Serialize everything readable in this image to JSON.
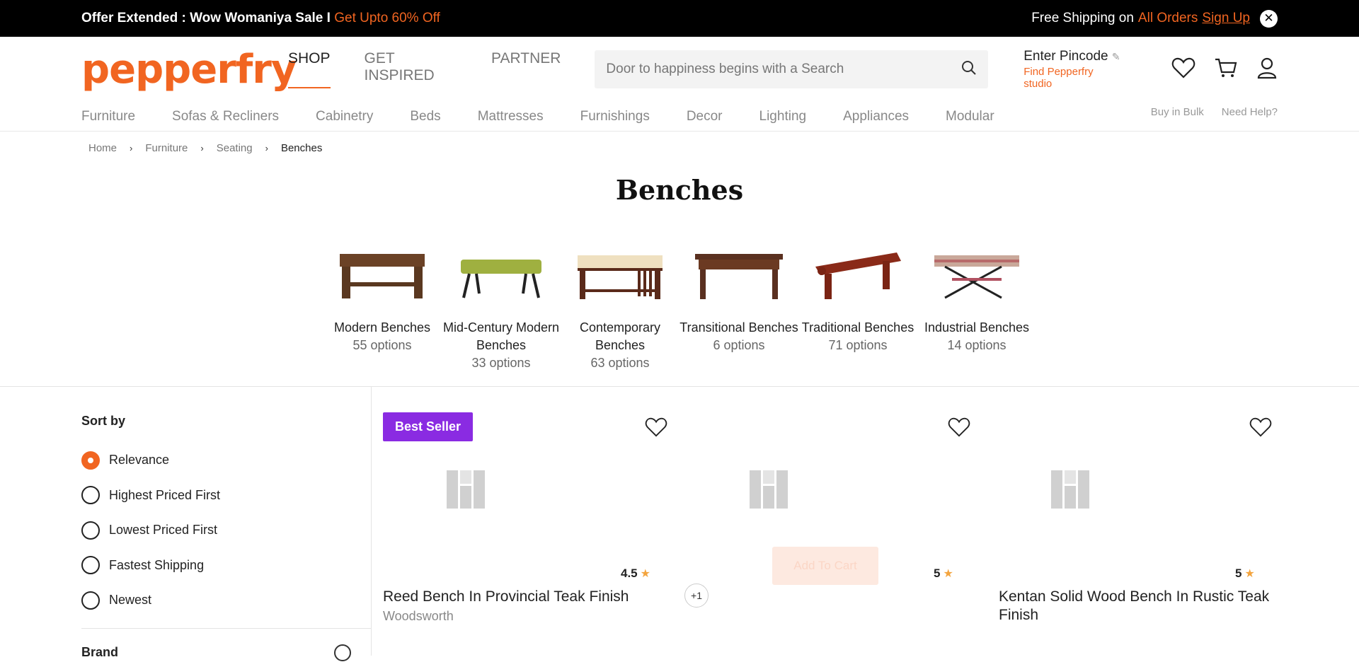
{
  "topbar": {
    "offer_text": "Offer Extended : Wow Womaniya Sale I",
    "offer_highlight": "Get Upto 60% Off",
    "shipping_text": "Free Shipping on",
    "shipping_highlight": "All Orders",
    "signup": "Sign Up",
    "close_icon": "close-icon"
  },
  "header": {
    "logo": "pepperfry",
    "nav": [
      "SHOP",
      "GET INSPIRED",
      "PARTNER"
    ],
    "search_placeholder": "Door to happiness begins with a Search",
    "pincode_label": "Enter Pincode",
    "pincode_link": "Find Pepperfry studio",
    "icons": [
      "heart-icon",
      "cart-icon",
      "user-icon"
    ]
  },
  "catnav": {
    "items": [
      "Furniture",
      "Sofas & Recliners",
      "Cabinetry",
      "Beds",
      "Mattresses",
      "Furnishings",
      "Decor",
      "Lighting",
      "Appliances",
      "Modular"
    ],
    "buy_bulk": "Buy in Bulk",
    "need_help": "Need Help?"
  },
  "breadcrumb": [
    "Home",
    "Furniture",
    "Seating",
    "Benches"
  ],
  "page_title": "Benches",
  "subcategories": [
    {
      "name": "Modern Benches",
      "count": "55 options"
    },
    {
      "name": "Mid-Century Modern Benches",
      "count": "33 options"
    },
    {
      "name": "Contemporary Benches",
      "count": "63 options"
    },
    {
      "name": "Transitional Benches",
      "count": "6 options"
    },
    {
      "name": "Traditional Benches",
      "count": "71 options"
    },
    {
      "name": "Industrial Benches",
      "count": "14 options"
    }
  ],
  "sort": {
    "title": "Sort by",
    "options": [
      "Relevance",
      "Highest Priced First",
      "Lowest Priced First",
      "Fastest Shipping",
      "Newest"
    ],
    "selected": "Relevance"
  },
  "filters": {
    "brand": "Brand"
  },
  "products": [
    {
      "badge": "Best Seller",
      "rating": "4.5",
      "title": "Reed Bench In Provincial Teak Finish",
      "brand": "Woodsworth",
      "extra": "+1"
    },
    {
      "rating": "5",
      "add_to_cart": "Add To Cart"
    },
    {
      "rating": "5",
      "title": "Kentan Solid Wood Bench In Rustic Teak Finish"
    }
  ],
  "colors": {
    "accent": "#f16521",
    "badge": "#8a2be2",
    "star": "#f3a43e"
  }
}
